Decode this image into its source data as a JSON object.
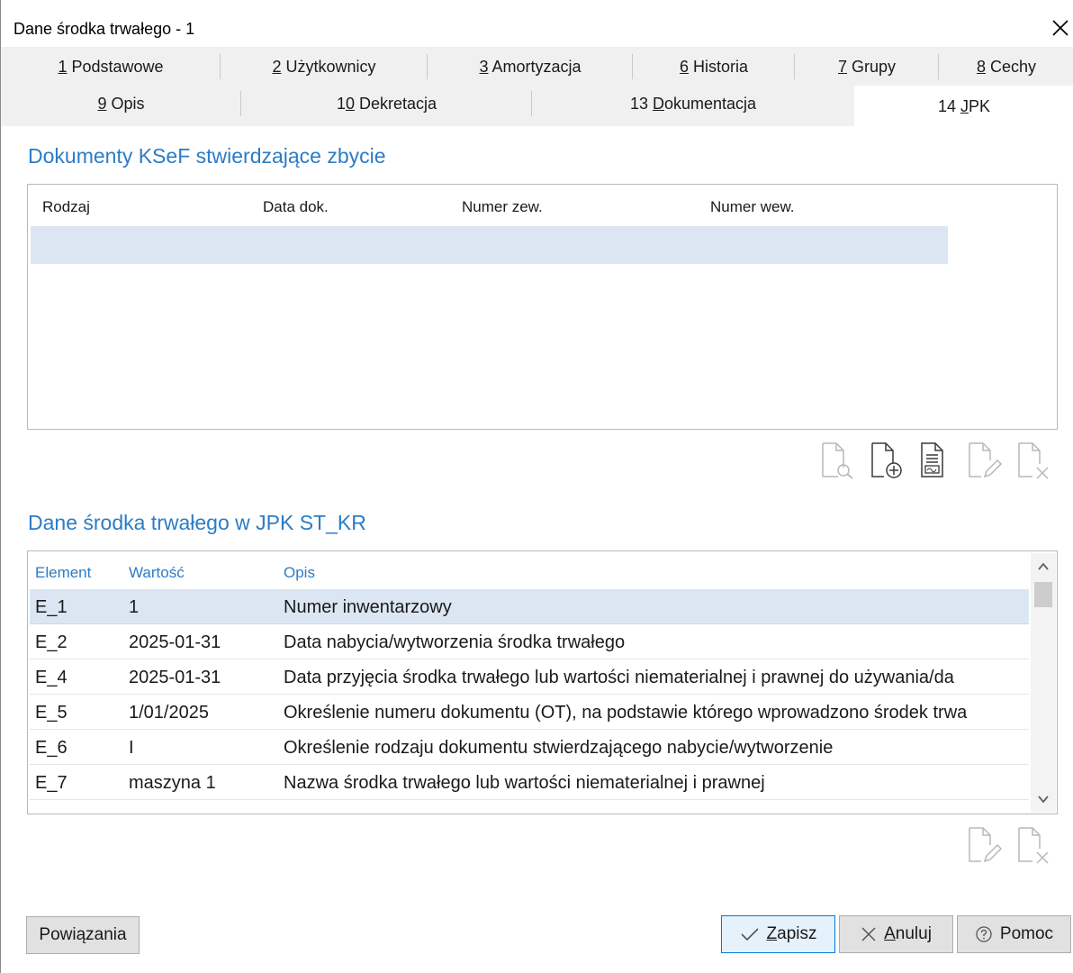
{
  "window": {
    "title": "Dane środka trwałego - 1"
  },
  "tabs_row1": [
    {
      "mnemonic": "1",
      "rest": " Podstawowe"
    },
    {
      "mnemonic": "2",
      "rest": " Użytkownicy"
    },
    {
      "mnemonic": "3",
      "rest": " Amortyzacja"
    },
    {
      "mnemonic": "6",
      "rest": " Historia"
    },
    {
      "mnemonic": "7",
      "rest": " Grupy"
    },
    {
      "mnemonic": "8",
      "rest": " Cechy"
    }
  ],
  "tabs_row2": [
    {
      "mnemonic": "9",
      "rest": " Opis"
    },
    {
      "prefix": "1",
      "mnemonic": "0",
      "rest": " Dekretacja"
    },
    {
      "prefix": "13 ",
      "mnemonic": "D",
      "rest": "okumentacja"
    },
    {
      "prefix": "14 ",
      "mnemonic": "J",
      "rest": "PK",
      "active": true
    }
  ],
  "ksef": {
    "title": "Dokumenty KSeF stwierdzające zbycie",
    "columns": [
      "Rodzaj",
      "Data dok.",
      "Numer zew.",
      "Numer wew."
    ],
    "rows": []
  },
  "jpk": {
    "title": "Dane środka trwałego w JPK ST_KR",
    "columns": [
      "Element",
      "Wartość",
      "Opis"
    ],
    "rows": [
      {
        "element": "E_1",
        "value": "1",
        "desc": "Numer inwentarzowy"
      },
      {
        "element": "E_2",
        "value": "2025-01-31",
        "desc": "Data nabycia/wytworzenia środka trwałego"
      },
      {
        "element": "E_4",
        "value": "2025-01-31",
        "desc": "Data przyjęcia środka trwałego lub wartości niematerialnej i prawnej do używania/da"
      },
      {
        "element": "E_5",
        "value": "1/01/2025",
        "desc": "Określenie numeru dokumentu (OT), na podstawie którego wprowadzono środek trwa"
      },
      {
        "element": "E_6",
        "value": "I",
        "desc": "Określenie rodzaju dokumentu stwierdzającego nabycie/wytworzenie"
      },
      {
        "element": "E_7",
        "value": "maszyna 1",
        "desc": "Nazwa środka trwałego lub wartości niematerialnej i prawnej"
      }
    ]
  },
  "buttons": {
    "links": "Powiązania",
    "save_mn": "Z",
    "save_rest": "apisz",
    "cancel_mn": "A",
    "cancel_rest": "nuluj",
    "help": "Pomoc"
  },
  "colors": {
    "accent": "#2b7cc7",
    "selection": "#dce6f2",
    "tabstrip": "#f0f0f0"
  }
}
